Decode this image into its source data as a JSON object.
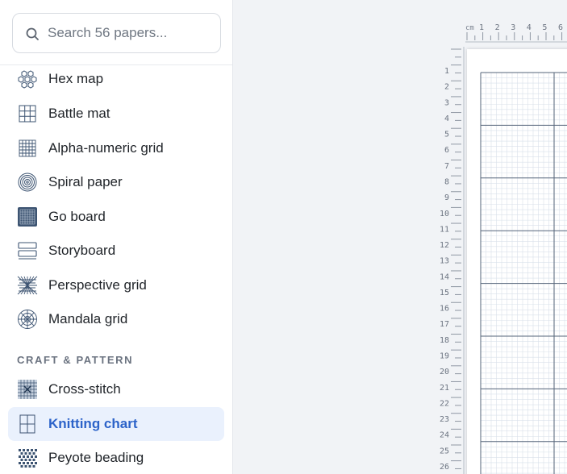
{
  "search": {
    "placeholder": "Search 56 papers..."
  },
  "sidebar": {
    "items": [
      {
        "label": "Hex map",
        "icon": "hex-map-icon"
      },
      {
        "label": "Battle mat",
        "icon": "battle-mat-icon"
      },
      {
        "label": "Alpha-numeric grid",
        "icon": "alphanumeric-grid-icon"
      },
      {
        "label": "Spiral paper",
        "icon": "spiral-icon"
      },
      {
        "label": "Go board",
        "icon": "go-board-icon"
      },
      {
        "label": "Storyboard",
        "icon": "storyboard-icon"
      },
      {
        "label": "Perspective grid",
        "icon": "perspective-grid-icon"
      },
      {
        "label": "Mandala grid",
        "icon": "mandala-grid-icon"
      }
    ],
    "section_craft": "CRAFT & PATTERN",
    "craft_items": [
      {
        "label": "Cross-stitch",
        "icon": "cross-stitch-icon"
      },
      {
        "label": "Knitting chart",
        "icon": "knitting-chart-icon",
        "active": true
      },
      {
        "label": "Peyote beading",
        "icon": "peyote-beading-icon"
      }
    ]
  },
  "ruler": {
    "unit": "cm",
    "h_numbers": [
      "1",
      "2",
      "3",
      "4",
      "5",
      "6"
    ],
    "v_numbers": [
      "1",
      "2",
      "3",
      "4",
      "5",
      "6",
      "7",
      "8",
      "9",
      "10",
      "11",
      "12",
      "13",
      "14",
      "15",
      "16",
      "17",
      "18",
      "19",
      "20",
      "21",
      "22",
      "23",
      "24",
      "25",
      "26"
    ]
  },
  "colors": {
    "accent": "#2c63c9",
    "active_bg": "#eaf1fd",
    "icon": "#3d5472"
  }
}
